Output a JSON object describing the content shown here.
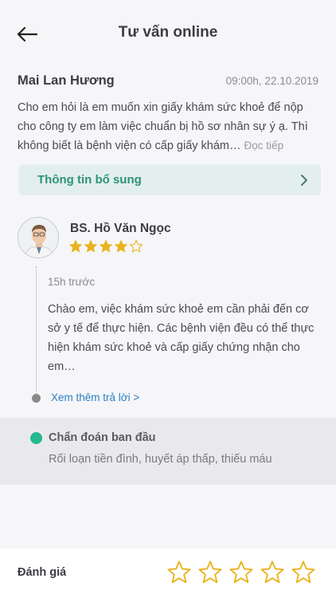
{
  "header": {
    "title": "Tư vấn online"
  },
  "question": {
    "author": "Mai Lan Hương",
    "time": "09:00h, 22.10.2019",
    "text": "Cho em hỏi là em muốn xin giấy khám sức khoẻ để nộp cho công ty em làm việc chuẩn bị hồ sơ nhân sự ý ạ. Thì không biết là bệnh viện có cấp giấy khám…",
    "more": "Đọc tiếp"
  },
  "info_bar": {
    "label": "Thông tin bổ sung"
  },
  "doctor": {
    "name": "BS. Hồ Văn Ngọc",
    "rating": 4,
    "max_rating": 5
  },
  "answer": {
    "time": "15h trước",
    "text": "Chào em, việc khám sức khoẻ em cần phải đến cơ sở y tế để thực hiện. Các bệnh viện đều có thể thực hiện khám sức khoẻ và cấp giấy chứng nhận cho em…",
    "see_more": "Xem thêm trả lời >"
  },
  "diagnosis": {
    "title": "Chẩn đoán ban đầu",
    "text": "Rối loạn tiền đình, huyết áp thấp, thiếu máu"
  },
  "rating": {
    "label": "Đánh giá",
    "stars": 5,
    "selected": 0
  },
  "colors": {
    "accent_green": "#2e9278",
    "dot_green": "#23b98e",
    "star_gold": "#e8b31e",
    "link_blue": "#2a7fc5"
  }
}
